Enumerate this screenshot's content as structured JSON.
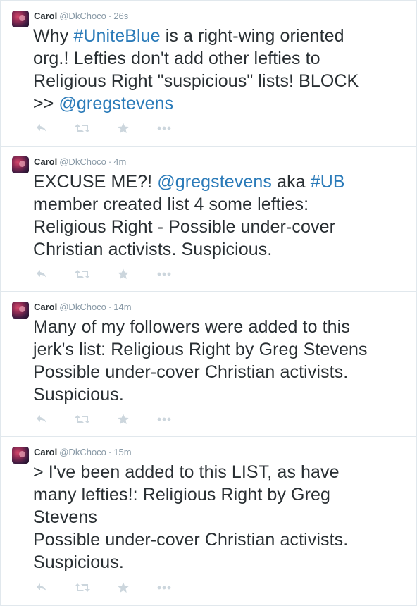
{
  "colors": {
    "link": "#2b7bb9",
    "meta": "#8899a6",
    "text": "#292f33",
    "icon": "#ccd6dd",
    "divider": "#e1e8ed"
  },
  "icons": [
    "reply-icon",
    "retweet-icon",
    "favorite-icon",
    "more-icon"
  ],
  "tweets": [
    {
      "name": "Carol",
      "handle": "@DkChoco",
      "sep": "·",
      "time": "26s",
      "parts": [
        "Why ",
        "#UniteBlue",
        " is a right-wing oriented\norg.! Lefties don't add other lefties to\nReligious Right \"suspicious\" lists! BLOCK\n>> ",
        "@gregstevens"
      ]
    },
    {
      "name": "Carol",
      "handle": "@DkChoco",
      "sep": "·",
      "time": "4m",
      "parts": [
        "EXCUSE ME?! ",
        "@gregstevens",
        " aka ",
        "#UB",
        "\nmember created list 4 some lefties:\nReligious Right - Possible under-cover\nChristian activists. Suspicious."
      ]
    },
    {
      "name": "Carol",
      "handle": "@DkChoco",
      "sep": "·",
      "time": "14m",
      "parts": [
        "Many of my followers were added to this\njerk's list: Religious Right by Greg Stevens\nPossible under-cover Christian activists.\nSuspicious."
      ]
    },
    {
      "name": "Carol",
      "handle": "@DkChoco",
      "sep": "·",
      "time": "15m",
      "parts": [
        "> I've been added to this LIST, as have\nmany lefties!: Religious Right by Greg\nStevens\nPossible under-cover Christian activists.\nSuspicious."
      ]
    }
  ]
}
